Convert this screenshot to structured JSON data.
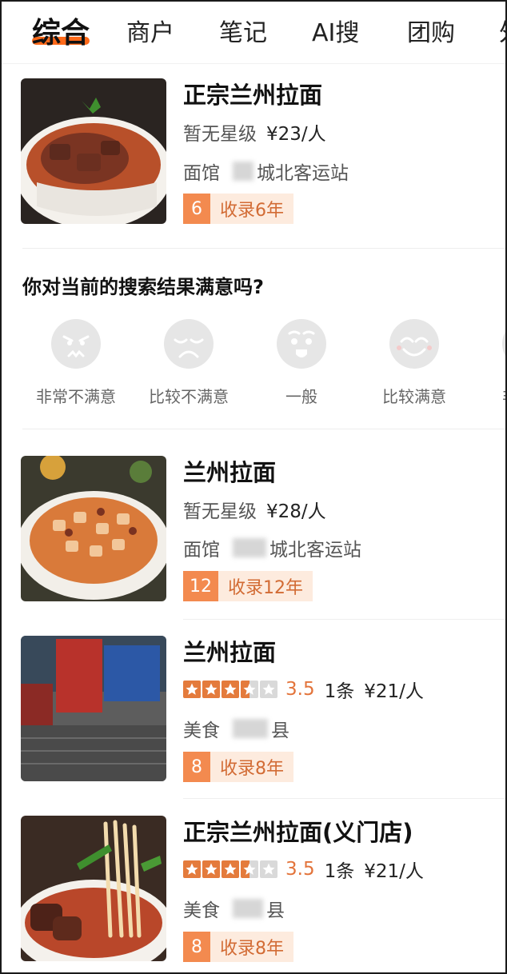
{
  "tabs": [
    {
      "label": "综合",
      "active": true
    },
    {
      "label": "商户",
      "active": false
    },
    {
      "label": "笔记",
      "active": false
    },
    {
      "label": "AI搜",
      "active": false
    },
    {
      "label": "团购",
      "active": false
    },
    {
      "label": "外",
      "active": false
    }
  ],
  "results_top": [
    {
      "name": "正宗兰州拉面",
      "rating_text": "暂无星级",
      "price": "¥23/人",
      "category": "面馆",
      "location": "城北客运站",
      "location_prefix": "8",
      "badge_num": "6",
      "badge_text": "收录6年"
    }
  ],
  "survey": {
    "question": "你对当前的搜索结果满意吗?",
    "options": [
      {
        "label": "非常不满意",
        "icon": "angry-face-icon"
      },
      {
        "label": "比较不满意",
        "icon": "sad-face-icon"
      },
      {
        "label": "一般",
        "icon": "neutral-face-icon"
      },
      {
        "label": "比较满意",
        "icon": "smile-face-icon"
      },
      {
        "label": "非",
        "icon": "happy-face-icon"
      }
    ]
  },
  "results": [
    {
      "name": "兰州拉面",
      "rating_text": "暂无星级",
      "price": "¥28/人",
      "category": "面馆",
      "location": "城北客运站",
      "badge_num": "12",
      "badge_text": "收录12年"
    },
    {
      "name": "兰州拉面",
      "stars": 3.5,
      "score": "3.5",
      "reviews": "1条",
      "price": "¥21/人",
      "category": "美食",
      "location": "县",
      "badge_num": "8",
      "badge_text": "收录8年"
    },
    {
      "name": "正宗兰州拉面(义门店)",
      "stars": 3.5,
      "score": "3.5",
      "reviews": "1条",
      "price": "¥21/人",
      "category": "美食",
      "location": "县",
      "badge_num": "8",
      "badge_text": "收录8年"
    }
  ],
  "colors": {
    "accent": "#ff6a1a",
    "badge_num_bg": "#f38a4f",
    "badge_text_bg": "#fdebde",
    "star": "#e47b3c"
  }
}
